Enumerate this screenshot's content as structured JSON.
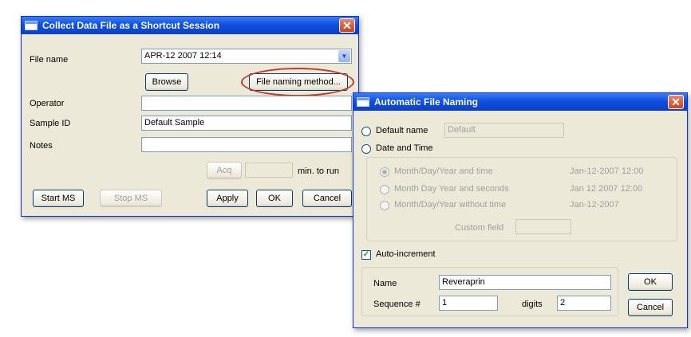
{
  "dialog1": {
    "title": "Collect Data File as a Shortcut Session",
    "file_name_label": "File name",
    "file_name_value": "APR-12 2007 12:14",
    "browse_label": "Browse",
    "file_naming_method_label": "File naming method...",
    "operator_label": "Operator",
    "operator_value": "",
    "sample_id_label": "Sample ID",
    "sample_id_value": "Default Sample",
    "notes_label": "Notes",
    "notes_value": "",
    "acq_label": "Acq",
    "acq_value": "",
    "units_label": "min. to run",
    "start_ms_label": "Start MS",
    "stop_ms_label": "Stop MS",
    "apply_label": "Apply",
    "ok_label": "OK",
    "cancel_label": "Cancel",
    "close_glyph": "✕"
  },
  "dialog2": {
    "title": "Automatic File Naming",
    "default_name_label": "Default name",
    "default_name_value": "Default",
    "date_time_label": "Date and Time",
    "format_options": [
      {
        "label": "Month/Day/Year and time",
        "example": "Jan-12-2007 12:00"
      },
      {
        "label": "Month Day Year and seconds",
        "example": "Jan 12 2007 12:00"
      },
      {
        "label": "Month/Day/Year without time",
        "example": "Jan-12-2007"
      }
    ],
    "prefix_label": "Custom field",
    "prefix_value": "",
    "auto_increment_label": "Auto-increment",
    "name_label": "Name",
    "name_value": "Reveraprin",
    "sequence_label": "Sequence #",
    "sequence_value": "1",
    "digits_label": "digits",
    "digits_value": "2",
    "ok_label": "OK",
    "cancel_label": "Cancel",
    "close_glyph": "✕"
  }
}
